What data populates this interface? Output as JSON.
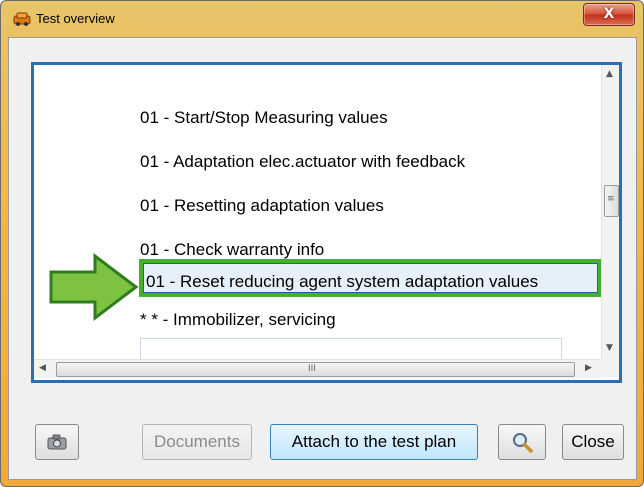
{
  "window": {
    "title": "Test overview",
    "close_label": "X"
  },
  "list": {
    "items": [
      {
        "label": "01 - Start/Stop Measuring values",
        "selected": false
      },
      {
        "label": "01 - Adaptation elec.actuator with feedback",
        "selected": false
      },
      {
        "label": "01 - Resetting adaptation values",
        "selected": false
      },
      {
        "label": "01 - Check warranty info",
        "selected": false
      },
      {
        "label": "01 - Reset reducing agent system adaptation values",
        "selected": true
      },
      {
        "label": "* * - Immobilizer, servicing",
        "selected": false
      }
    ],
    "scroll_up_glyph": "▲",
    "scroll_down_glyph": "▼",
    "scroll_left_glyph": "◀",
    "scroll_right_glyph": "▶",
    "vthumb_grip": "≡",
    "hthumb_grip": "III"
  },
  "buttons": {
    "camera_icon": "camera-icon",
    "documents": "Documents",
    "attach": "Attach to the test plan",
    "search_icon": "magnifier-icon",
    "close": "Close"
  },
  "annotation": {
    "arrow_icon": "green-arrow-icon",
    "highlight_color": "#44b02d"
  }
}
